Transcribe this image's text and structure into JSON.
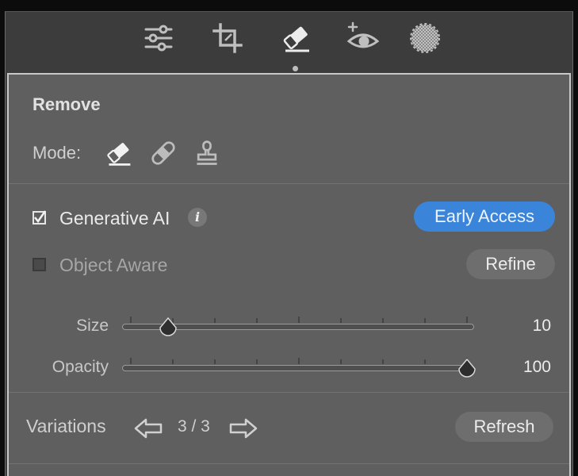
{
  "toolstrip": {
    "tools": [
      {
        "icon": "sliders-icon",
        "label": "Edit"
      },
      {
        "icon": "crop-icon",
        "label": "Crop"
      },
      {
        "icon": "eraser-icon",
        "label": "Remove",
        "active": true
      },
      {
        "icon": "eye-add-icon",
        "label": "Red Eye"
      },
      {
        "icon": "mask-icon",
        "label": "Masking"
      }
    ]
  },
  "panel": {
    "title": "Remove",
    "mode": {
      "label": "Mode:",
      "options": [
        "eraser-icon",
        "bandage-icon",
        "stamp-icon"
      ],
      "selected": "eraser-icon"
    },
    "generative_ai": {
      "label": "Generative AI",
      "checked": true,
      "info": "i",
      "badge": "Early Access"
    },
    "object_aware": {
      "label": "Object Aware",
      "checked": false,
      "refine_label": "Refine"
    },
    "size": {
      "label": "Size",
      "value": "10",
      "fraction": 0.11
    },
    "opacity": {
      "label": "Opacity",
      "value": "100",
      "fraction": 1.0
    },
    "variations": {
      "label": "Variations",
      "count": "3 / 3",
      "refresh_label": "Refresh"
    }
  },
  "colors": {
    "accent": "#3a84d9",
    "panel_bg": "#5f5f5f",
    "toolstrip_bg": "#3c3c3c"
  }
}
